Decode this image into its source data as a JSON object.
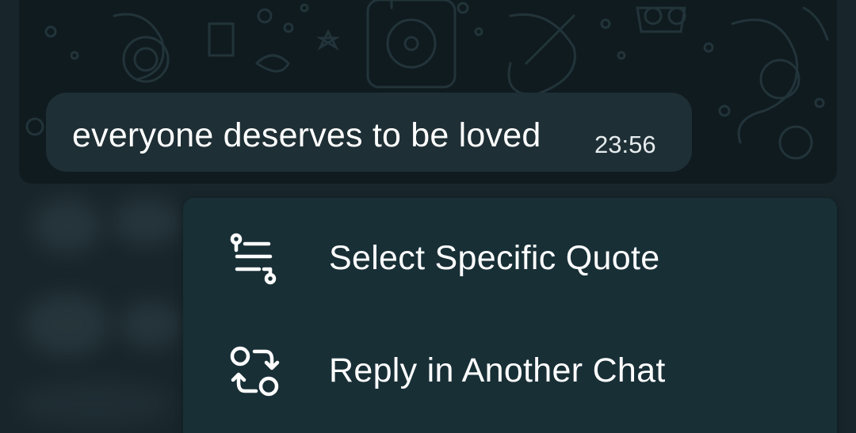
{
  "message": {
    "text": "everyone deserves to be loved",
    "time": "23:56"
  },
  "menu": {
    "items": [
      {
        "label": "Select Specific Quote",
        "icon": "quote-select-icon"
      },
      {
        "label": "Reply in Another Chat",
        "icon": "reply-another-chat-icon"
      }
    ]
  },
  "colors": {
    "background": "#18262b",
    "chat_background": "#0f1b1f",
    "bubble": "#1e2f35",
    "menu": "#182f36",
    "text": "#ffffff"
  }
}
